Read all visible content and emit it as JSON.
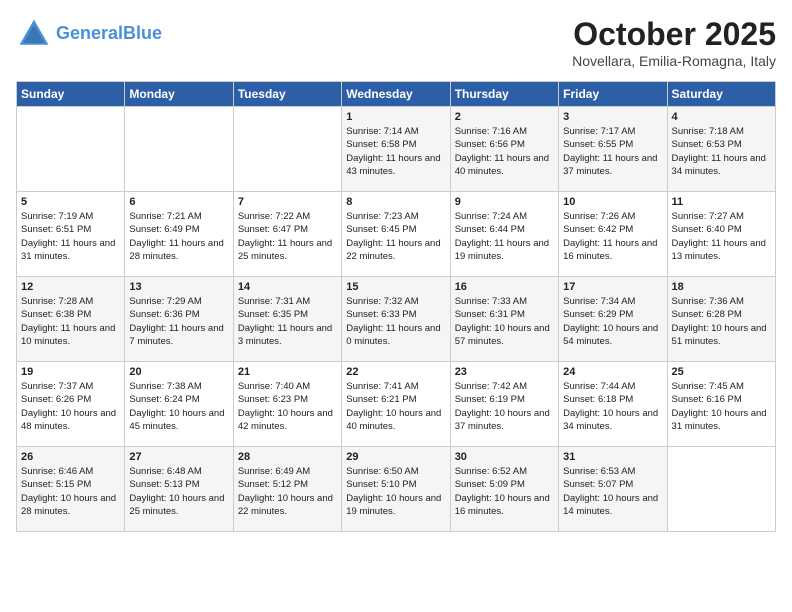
{
  "header": {
    "logo_line1": "General",
    "logo_line2": "Blue",
    "month": "October 2025",
    "location": "Novellara, Emilia-Romagna, Italy"
  },
  "days_of_week": [
    "Sunday",
    "Monday",
    "Tuesday",
    "Wednesday",
    "Thursday",
    "Friday",
    "Saturday"
  ],
  "weeks": [
    [
      {
        "day": "",
        "info": ""
      },
      {
        "day": "",
        "info": ""
      },
      {
        "day": "",
        "info": ""
      },
      {
        "day": "1",
        "info": "Sunrise: 7:14 AM\nSunset: 6:58 PM\nDaylight: 11 hours\nand 43 minutes."
      },
      {
        "day": "2",
        "info": "Sunrise: 7:16 AM\nSunset: 6:56 PM\nDaylight: 11 hours\nand 40 minutes."
      },
      {
        "day": "3",
        "info": "Sunrise: 7:17 AM\nSunset: 6:55 PM\nDaylight: 11 hours\nand 37 minutes."
      },
      {
        "day": "4",
        "info": "Sunrise: 7:18 AM\nSunset: 6:53 PM\nDaylight: 11 hours\nand 34 minutes."
      }
    ],
    [
      {
        "day": "5",
        "info": "Sunrise: 7:19 AM\nSunset: 6:51 PM\nDaylight: 11 hours\nand 31 minutes."
      },
      {
        "day": "6",
        "info": "Sunrise: 7:21 AM\nSunset: 6:49 PM\nDaylight: 11 hours\nand 28 minutes."
      },
      {
        "day": "7",
        "info": "Sunrise: 7:22 AM\nSunset: 6:47 PM\nDaylight: 11 hours\nand 25 minutes."
      },
      {
        "day": "8",
        "info": "Sunrise: 7:23 AM\nSunset: 6:45 PM\nDaylight: 11 hours\nand 22 minutes."
      },
      {
        "day": "9",
        "info": "Sunrise: 7:24 AM\nSunset: 6:44 PM\nDaylight: 11 hours\nand 19 minutes."
      },
      {
        "day": "10",
        "info": "Sunrise: 7:26 AM\nSunset: 6:42 PM\nDaylight: 11 hours\nand 16 minutes."
      },
      {
        "day": "11",
        "info": "Sunrise: 7:27 AM\nSunset: 6:40 PM\nDaylight: 11 hours\nand 13 minutes."
      }
    ],
    [
      {
        "day": "12",
        "info": "Sunrise: 7:28 AM\nSunset: 6:38 PM\nDaylight: 11 hours\nand 10 minutes."
      },
      {
        "day": "13",
        "info": "Sunrise: 7:29 AM\nSunset: 6:36 PM\nDaylight: 11 hours\nand 7 minutes."
      },
      {
        "day": "14",
        "info": "Sunrise: 7:31 AM\nSunset: 6:35 PM\nDaylight: 11 hours\nand 3 minutes."
      },
      {
        "day": "15",
        "info": "Sunrise: 7:32 AM\nSunset: 6:33 PM\nDaylight: 11 hours\nand 0 minutes."
      },
      {
        "day": "16",
        "info": "Sunrise: 7:33 AM\nSunset: 6:31 PM\nDaylight: 10 hours\nand 57 minutes."
      },
      {
        "day": "17",
        "info": "Sunrise: 7:34 AM\nSunset: 6:29 PM\nDaylight: 10 hours\nand 54 minutes."
      },
      {
        "day": "18",
        "info": "Sunrise: 7:36 AM\nSunset: 6:28 PM\nDaylight: 10 hours\nand 51 minutes."
      }
    ],
    [
      {
        "day": "19",
        "info": "Sunrise: 7:37 AM\nSunset: 6:26 PM\nDaylight: 10 hours\nand 48 minutes."
      },
      {
        "day": "20",
        "info": "Sunrise: 7:38 AM\nSunset: 6:24 PM\nDaylight: 10 hours\nand 45 minutes."
      },
      {
        "day": "21",
        "info": "Sunrise: 7:40 AM\nSunset: 6:23 PM\nDaylight: 10 hours\nand 42 minutes."
      },
      {
        "day": "22",
        "info": "Sunrise: 7:41 AM\nSunset: 6:21 PM\nDaylight: 10 hours\nand 40 minutes."
      },
      {
        "day": "23",
        "info": "Sunrise: 7:42 AM\nSunset: 6:19 PM\nDaylight: 10 hours\nand 37 minutes."
      },
      {
        "day": "24",
        "info": "Sunrise: 7:44 AM\nSunset: 6:18 PM\nDaylight: 10 hours\nand 34 minutes."
      },
      {
        "day": "25",
        "info": "Sunrise: 7:45 AM\nSunset: 6:16 PM\nDaylight: 10 hours\nand 31 minutes."
      }
    ],
    [
      {
        "day": "26",
        "info": "Sunrise: 6:46 AM\nSunset: 5:15 PM\nDaylight: 10 hours\nand 28 minutes."
      },
      {
        "day": "27",
        "info": "Sunrise: 6:48 AM\nSunset: 5:13 PM\nDaylight: 10 hours\nand 25 minutes."
      },
      {
        "day": "28",
        "info": "Sunrise: 6:49 AM\nSunset: 5:12 PM\nDaylight: 10 hours\nand 22 minutes."
      },
      {
        "day": "29",
        "info": "Sunrise: 6:50 AM\nSunset: 5:10 PM\nDaylight: 10 hours\nand 19 minutes."
      },
      {
        "day": "30",
        "info": "Sunrise: 6:52 AM\nSunset: 5:09 PM\nDaylight: 10 hours\nand 16 minutes."
      },
      {
        "day": "31",
        "info": "Sunrise: 6:53 AM\nSunset: 5:07 PM\nDaylight: 10 hours\nand 14 minutes."
      },
      {
        "day": "",
        "info": ""
      }
    ]
  ]
}
